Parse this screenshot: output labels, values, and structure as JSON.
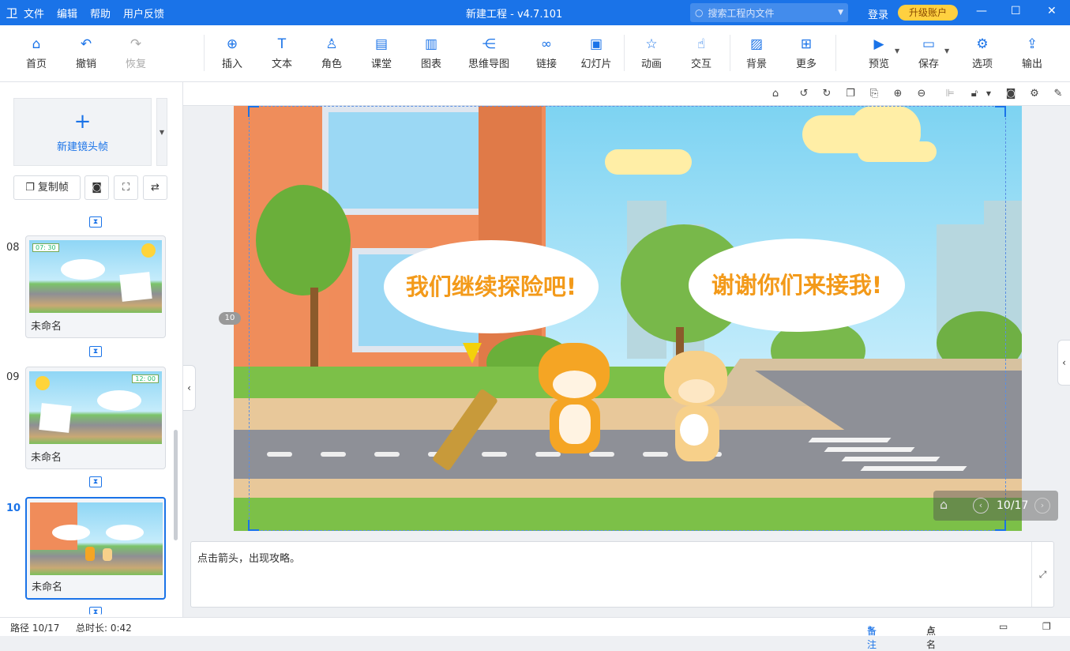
{
  "titlebar": {
    "menus": [
      "文件",
      "编辑",
      "帮助",
      "用户反馈"
    ],
    "title": "新建工程 - v4.7.101",
    "search_placeholder": "搜索工程内文件",
    "login": "登录",
    "upgrade": "升级账户"
  },
  "toolbar": {
    "home": "首页",
    "undo": "撤销",
    "redo": "恢复",
    "insert": "插入",
    "text": "文本",
    "role": "角色",
    "lesson": "课堂",
    "chart": "图表",
    "mindmap": "思维导图",
    "link": "链接",
    "slideshow": "幻灯片",
    "animation": "动画",
    "interaction": "交互",
    "background": "背景",
    "more": "更多",
    "preview": "预览",
    "save": "保存",
    "options": "选项",
    "export": "输出"
  },
  "sidebar": {
    "new_frame": "新建镜头帧",
    "copy_frame": "复制帧",
    "slides": [
      {
        "num": "08",
        "name": "未命名",
        "clock": "07: 30"
      },
      {
        "num": "09",
        "name": "未命名",
        "clock": "12: 00"
      },
      {
        "num": "10",
        "name": "未命名",
        "clock": ""
      }
    ]
  },
  "stage": {
    "bubble_left": "我们继续探险吧!",
    "bubble_right": "谢谢你们来接我!",
    "slide_tag": "10",
    "pager": "10/17"
  },
  "notes": {
    "text": "点击箭头，出现攻略。"
  },
  "status": {
    "path": "路径 10/17",
    "duration": "总时长: 0:42",
    "notes_btn": "备注",
    "rollcall_btn": "点名"
  }
}
